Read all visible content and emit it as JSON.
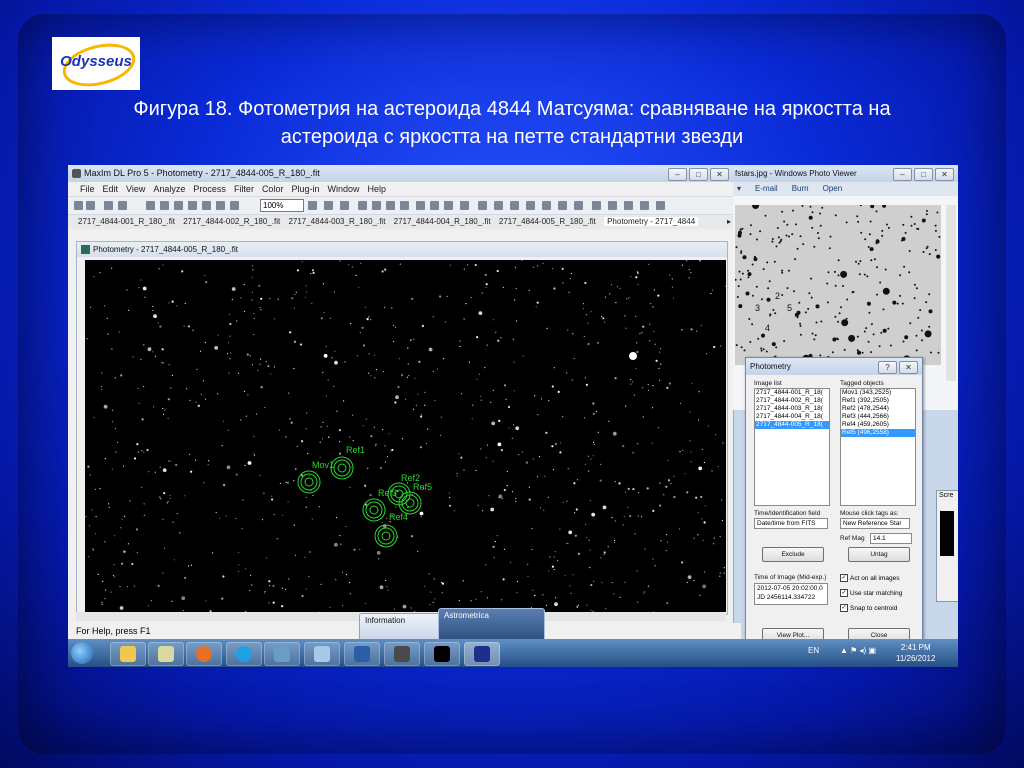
{
  "slide": {
    "logo_text": "Odysseus",
    "caption_line1": "Фигура 18. Фотометрия на астероида 4844 Матсуяма: сравняване на яркостта на",
    "caption_line2": "астероида с яркостта на петте стандартни звезди"
  },
  "maxim": {
    "title": "MaxIm DL Pro 5 - Photometry - 2717_4844-005_R_180_.fit",
    "menu": [
      "File",
      "Edit",
      "View",
      "Analyze",
      "Process",
      "Filter",
      "Color",
      "Plug-in",
      "Window",
      "Help"
    ],
    "zoom": "100%",
    "tabs": [
      "2717_4844-001_R_180_.fit",
      "2717_4844-002_R_180_.fit",
      "2717_4844-003_R_180_.fit",
      "2717_4844-004_R_180_.fit",
      "2717_4844-005_R_180_.fit",
      "Photometry - 2717_4844"
    ],
    "image_window_title": "Photometry - 2717_4844-005_R_180_.fit",
    "status": "For Help, press F1",
    "star_labels": [
      "Mov1",
      "Ref1",
      "Ref2",
      "Ref3",
      "Ref4",
      "Ref5"
    ]
  },
  "viewer": {
    "title": "fstars.jpg - Windows Photo Viewer",
    "menu": [
      "E-mail",
      "Burn",
      "Open"
    ],
    "labels": [
      "2",
      "3",
      "5",
      "4"
    ]
  },
  "photometry": {
    "title": "Photometry",
    "image_list_label": "Image list",
    "image_list": [
      "2717_4844-001_R_18(",
      "2717_4844-002_R_18(",
      "2717_4844-003_R_18(",
      "2717_4844-004_R_18(",
      "2717_4844-005_R_18("
    ],
    "tagged_label": "Tagged objects",
    "tagged": [
      "Mov1 (343,2525)",
      "Ref1 (392,2505)",
      "Ref2 (478,2544)",
      "Ref3 (444,2566)",
      "Ref4 (459,2605)",
      "Ref5 (496,2558)"
    ],
    "time_id_label": "Time/Identification field",
    "time_id_value": "Date/time from FITS",
    "mouse_tags_label": "Mouse click tags as:",
    "mouse_tags_value": "New Reference Star",
    "ref_mag_label": "Ref Mag",
    "ref_mag_value": "14.1",
    "exclude": "Exclude",
    "untag": "Untag",
    "time_of_image_label": "Time of Image (Mid-exp.)",
    "time_of_image_1": "2012-07-05  20:02:00.0",
    "time_of_image_2": "JD 2456114.334722",
    "act_on_all": "Act on all images",
    "use_star_matching": "Use star matching",
    "snap_to_centroid": "Snap to centroid",
    "view_plot": "View Plot...",
    "close": "Close"
  },
  "taskbar": {
    "popup_information": "Information",
    "popup_astrometrica": "Astrometrica",
    "lang": "EN",
    "time": "2:41 PM",
    "date": "11/26/2012",
    "side_window": "Scre"
  }
}
